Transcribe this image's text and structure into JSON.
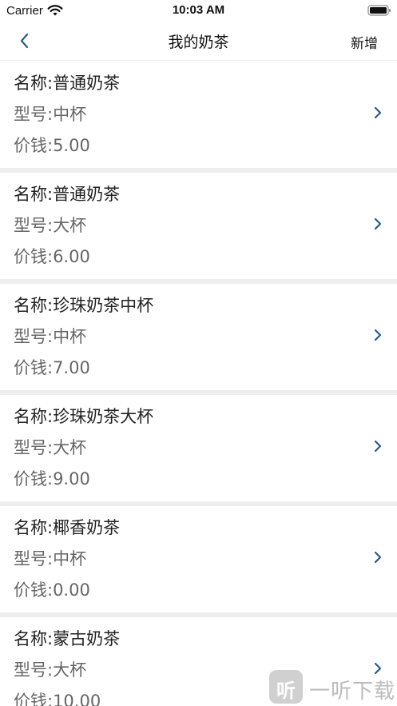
{
  "status_bar": {
    "carrier": "Carrier",
    "time": "10:03 AM"
  },
  "nav": {
    "title": "我的奶茶",
    "add_label": "新增"
  },
  "items": [
    {
      "name": "名称:普通奶茶",
      "model": "型号:中杯",
      "price": "价钱:5.00"
    },
    {
      "name": "名称:普通奶茶",
      "model": "型号:大杯",
      "price": "价钱:6.00"
    },
    {
      "name": "名称:珍珠奶茶中杯",
      "model": "型号:中杯",
      "price": "价钱:7.00"
    },
    {
      "name": "名称:珍珠奶茶大杯",
      "model": "型号:大杯",
      "price": "价钱:9.00"
    },
    {
      "name": "名称:椰香奶茶",
      "model": "型号:中杯",
      "price": "价钱:0.00"
    },
    {
      "name": "名称:蒙古奶茶",
      "model": "型号:大杯",
      "price": "价钱:10.00"
    }
  ],
  "watermark": {
    "glyph": "听",
    "text": "一听下载"
  },
  "colors": {
    "accent": "#2a5b8a",
    "separator": "#eeeeee"
  }
}
